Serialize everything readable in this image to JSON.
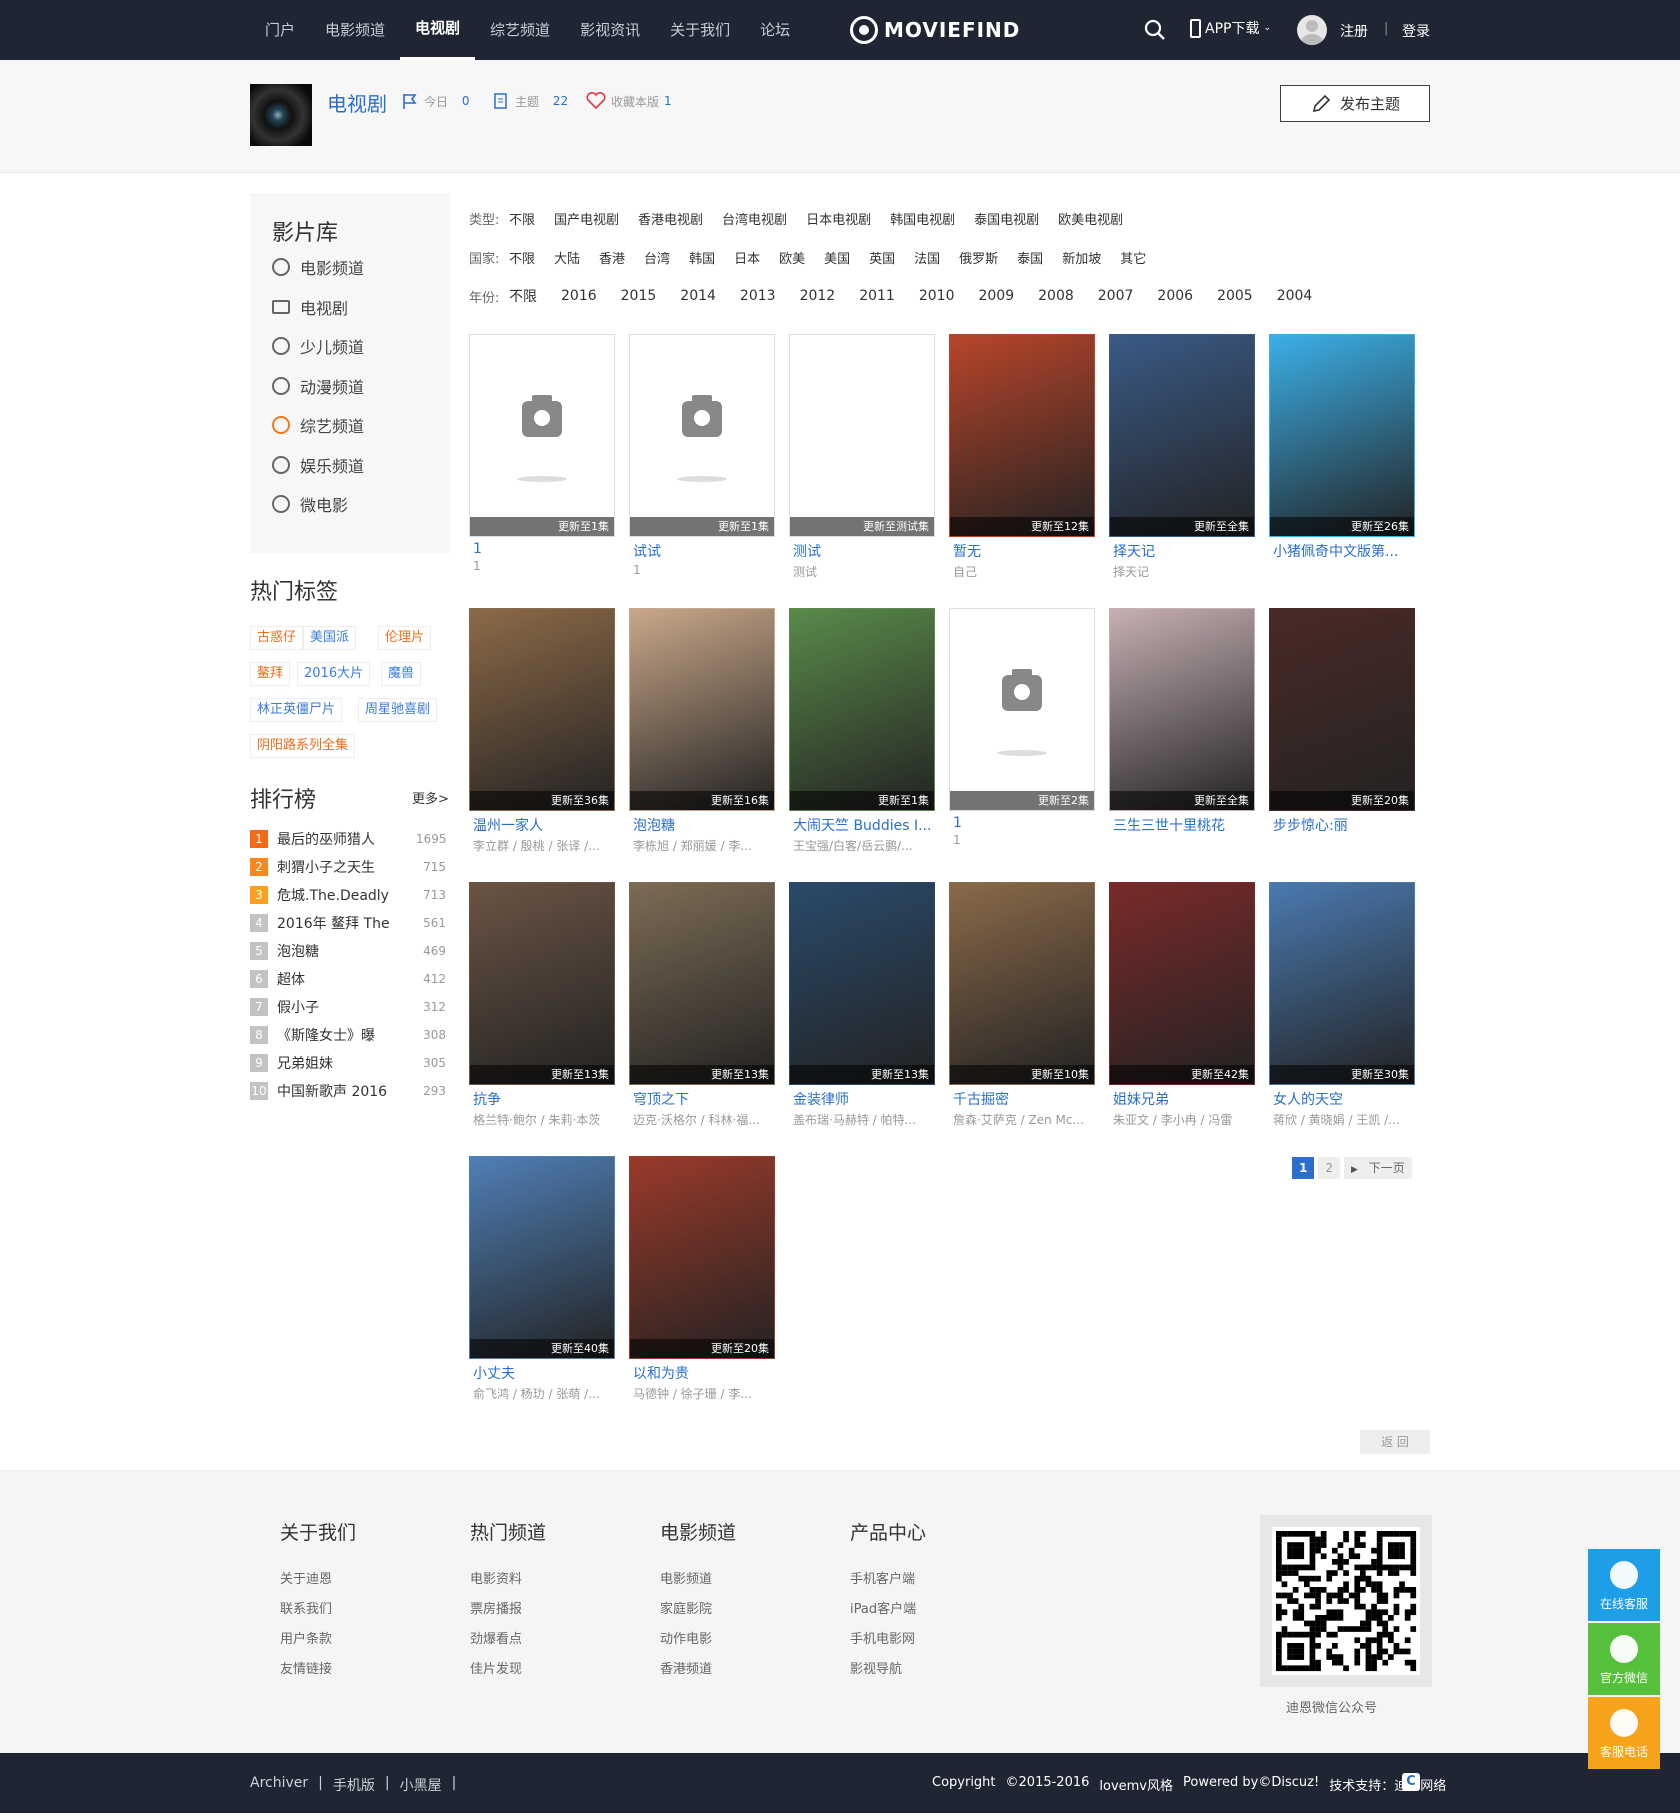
{
  "topnav": {
    "items": [
      "门户",
      "电影频道",
      "电视剧",
      "综艺频道",
      "影视资讯",
      "关于我们",
      "论坛"
    ],
    "active_index": 2,
    "logo": "MOVIEFIND",
    "app_download": "APP下载",
    "register": "注册",
    "separator": "|",
    "login": "登录"
  },
  "forum": {
    "title": "电视剧",
    "today_label": "今日",
    "today_value": "0",
    "topics_label": "主题",
    "topics_value": "22",
    "favorite": "收藏本版",
    "favorite_count": "1",
    "post_button": "发布主题"
  },
  "sidebar": {
    "library_title": "影片库",
    "library_items": [
      {
        "label": "电影频道",
        "icon": "film-reel-icon"
      },
      {
        "label": "电视剧",
        "icon": "monitor-icon"
      },
      {
        "label": "少儿频道",
        "icon": "kid-icon"
      },
      {
        "label": "动漫频道",
        "icon": "anime-icon"
      },
      {
        "label": "综艺频道",
        "icon": "star-vip-icon"
      },
      {
        "label": "娱乐频道",
        "icon": "entertainment-icon"
      },
      {
        "label": "微电影",
        "icon": "film-reel-icon"
      }
    ],
    "tags_title": "热门标签",
    "tags": [
      "古惑仔",
      "美国派",
      "伦理片",
      "鳌拜",
      "2016大片",
      "魔兽",
      "林正英僵尸片",
      "周星驰喜剧",
      "阴阳路系列全集"
    ],
    "rank_title": "排行榜",
    "rank_more": "更多>",
    "rank": [
      {
        "n": "1",
        "title": "最后的巫师猎人",
        "count": "1695"
      },
      {
        "n": "2",
        "title": "刺猬小子之天生",
        "count": "715"
      },
      {
        "n": "3",
        "title": "危城.The.Deadly",
        "count": "713"
      },
      {
        "n": "4",
        "title": "2016年 鳌拜 The",
        "count": "561"
      },
      {
        "n": "5",
        "title": "泡泡糖",
        "count": "469"
      },
      {
        "n": "6",
        "title": "超体",
        "count": "412"
      },
      {
        "n": "7",
        "title": "假小子",
        "count": "312"
      },
      {
        "n": "8",
        "title": "《斯隆女士》曝",
        "count": "308"
      },
      {
        "n": "9",
        "title": "兄弟姐妹",
        "count": "305"
      },
      {
        "n": "10",
        "title": "中国新歌声 2016",
        "count": "293"
      }
    ]
  },
  "filters": {
    "type_label": "类型:",
    "type_options": [
      "不限",
      "国产电视剧",
      "香港电视剧",
      "台湾电视剧",
      "日本电视剧",
      "韩国电视剧",
      "泰国电视剧",
      "欧美电视剧"
    ],
    "country_label": "国家:",
    "country_options": [
      "不限",
      "大陆",
      "香港",
      "台湾",
      "韩国",
      "日本",
      "欧美",
      "美国",
      "英国",
      "法国",
      "俄罗斯",
      "泰国",
      "新加坡",
      "其它"
    ],
    "year_label": "年份:",
    "year_options": [
      "不限",
      "2016",
      "2015",
      "2014",
      "2013",
      "2012",
      "2011",
      "2010",
      "2009",
      "2008",
      "2007",
      "2006",
      "2005",
      "2004"
    ]
  },
  "cards": [
    {
      "name": "1",
      "desc": "1",
      "badge": "更新至1集",
      "img": "placeholder"
    },
    {
      "name": "试试",
      "desc": "1",
      "badge": "更新至1集",
      "img": "placeholder"
    },
    {
      "name": "测试",
      "desc": "测试",
      "badge": "更新至测试集",
      "img": "broken"
    },
    {
      "name": "暂无",
      "desc": "自己",
      "badge": "更新至12集",
      "img": "poster",
      "color": "#b8452a"
    },
    {
      "name": "择天记",
      "desc": "择天记",
      "badge": "更新至全集",
      "img": "poster",
      "color": "#3a5a86"
    },
    {
      "name": "小猪佩奇中文版第...",
      "desc": "",
      "badge": "更新至26集",
      "img": "poster",
      "color": "#3bb0e8"
    },
    {
      "name": "温州一家人",
      "desc": "李立群 / 殷桃 / 张译 /...",
      "badge": "更新至36集",
      "img": "poster",
      "color": "#8c6a48"
    },
    {
      "name": "泡泡糖",
      "desc": "李栋旭 / 郑丽媛 / 李...",
      "badge": "更新至16集",
      "img": "poster",
      "color": "#c9a88a"
    },
    {
      "name": "大闹天竺 Buddies I...",
      "desc": "王宝强/白客/岳云鹏/...",
      "badge": "更新至1集",
      "img": "poster",
      "color": "#5a8a4a"
    },
    {
      "name": "1",
      "desc": "1",
      "badge": "更新至2集",
      "img": "placeholder"
    },
    {
      "name": "三生三世十里桃花",
      "desc": "",
      "badge": "更新至全集",
      "img": "poster",
      "color": "#c6b0b4"
    },
    {
      "name": "步步惊心:丽",
      "desc": "",
      "badge": "更新至20集",
      "img": "poster",
      "color": "#4a2a26"
    },
    {
      "name": "抗争",
      "desc": "格兰特·鲍尔 / 朱莉·本茨",
      "badge": "更新至13集",
      "img": "poster",
      "color": "#6a5444"
    },
    {
      "name": "穹顶之下",
      "desc": "迈克·沃格尔 / 科林·福...",
      "badge": "更新至13集",
      "img": "poster",
      "color": "#7d6c55"
    },
    {
      "name": "金装律师",
      "desc": "盖布瑞·马赫特 / 帕特...",
      "badge": "更新至13集",
      "img": "poster",
      "color": "#2a4a6a"
    },
    {
      "name": "千古掘密",
      "desc": "詹森·艾萨克 / Zen Mc...",
      "badge": "更新至10集",
      "img": "poster",
      "color": "#8a6a4a"
    },
    {
      "name": "姐妹兄弟",
      "desc": "朱亚文 / 李小冉 / 冯雷",
      "badge": "更新至42集",
      "img": "poster",
      "color": "#7a2a2a"
    },
    {
      "name": "女人的天空",
      "desc": "蒋欣 / 黄晓娟 / 王凯 /...",
      "badge": "更新至30集",
      "img": "poster",
      "color": "#4a7ab0"
    },
    {
      "name": "小丈夫",
      "desc": "俞飞鸿 / 杨玏 / 张萌 /...",
      "badge": "更新至40集",
      "img": "poster",
      "color": "#4f7fb5"
    },
    {
      "name": "以和为贵",
      "desc": "马德钟 / 徐子珊 / 李...",
      "badge": "更新至20集",
      "img": "poster",
      "color": "#9a3a2a"
    }
  ],
  "pager": {
    "pages": [
      "1",
      "2"
    ],
    "current": "1",
    "next": "下一页"
  },
  "back": "返 回",
  "footer": {
    "cols": [
      {
        "title": "关于我们",
        "links": [
          "关于迪恩",
          "联系我们",
          "用户条款",
          "友情链接"
        ]
      },
      {
        "title": "热门频道",
        "links": [
          "电影资料",
          "票房播报",
          "劲爆看点",
          "佳片发现"
        ]
      },
      {
        "title": "电影频道",
        "links": [
          "电影频道",
          "家庭影院",
          "动作电影",
          "香港频道"
        ]
      },
      {
        "title": "产品中心",
        "links": [
          "手机客户端",
          "iPad客户端",
          "手机电影网",
          "影视导航"
        ]
      }
    ],
    "qr_caption": "迪恩微信公众号",
    "bottom_links": [
      "Archiver",
      "|",
      "手机版",
      "|",
      "小黑屋",
      "|"
    ],
    "copyright": [
      "Copyright",
      "©2015-2016",
      "lovemv风格",
      "Powered by©Discuz!",
      "技术支持：迪恩网络"
    ]
  },
  "side_buttons": [
    {
      "label": "在线客服",
      "color": "#1f9ee8",
      "icon": "qq-icon"
    },
    {
      "label": "官方微信",
      "color": "#55c13a",
      "icon": "wechat-icon"
    },
    {
      "label": "客服电话",
      "color": "#f7a21b",
      "icon": "phone-icon"
    }
  ]
}
